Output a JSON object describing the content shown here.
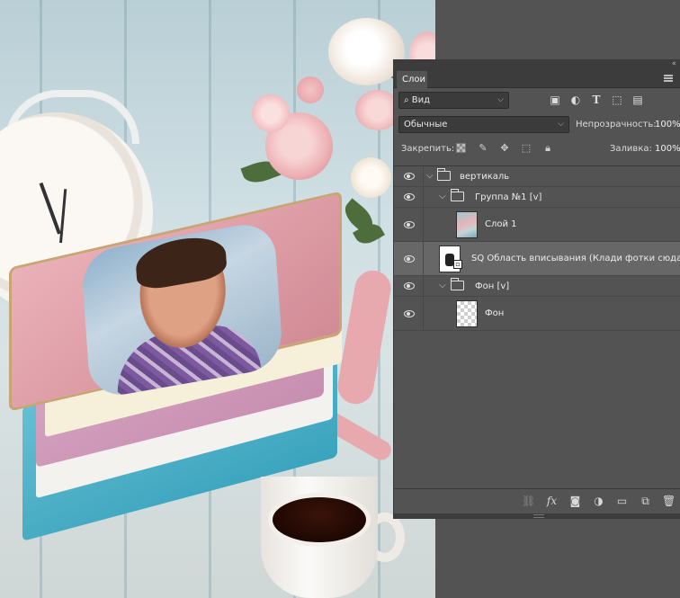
{
  "panel": {
    "tab_label": "Слои",
    "filter": {
      "value": "Вид",
      "search_icon": "search-icon",
      "icons": [
        "image-filter-icon",
        "adjustment-filter-icon",
        "type-filter-icon",
        "shape-filter-icon",
        "smart-object-filter-icon"
      ]
    },
    "blend": {
      "value": "Обычные",
      "opacity_label": "Непрозрачность:",
      "opacity_value": "100%"
    },
    "lock": {
      "label": "Закрепить:",
      "fill_label": "Заливка:",
      "fill_value": "100%"
    },
    "layers": [
      {
        "name": "вертикаль",
        "type": "group",
        "visible": true
      },
      {
        "name": "Группа №1 [v]",
        "type": "group",
        "visible": true
      },
      {
        "name": "Слой 1",
        "type": "image",
        "visible": true
      },
      {
        "name": "SQ Область вписывания (Клади фотки сюда) ...",
        "type": "smart-object",
        "visible": true,
        "selected": true
      },
      {
        "name": "Фон [v]",
        "type": "group",
        "visible": true
      },
      {
        "name": "Фон",
        "type": "transparent",
        "visible": true
      }
    ],
    "bottom_icons": [
      "link-layers-icon",
      "fx-icon",
      "add-mask-icon",
      "adjustment-layer-icon",
      "new-group-icon",
      "new-layer-icon",
      "trash-icon"
    ],
    "fx_label": "fx"
  },
  "colors": {
    "panel_bg": "#535353",
    "selected_row": "#676767",
    "tab_bar": "#3c3c3c"
  }
}
